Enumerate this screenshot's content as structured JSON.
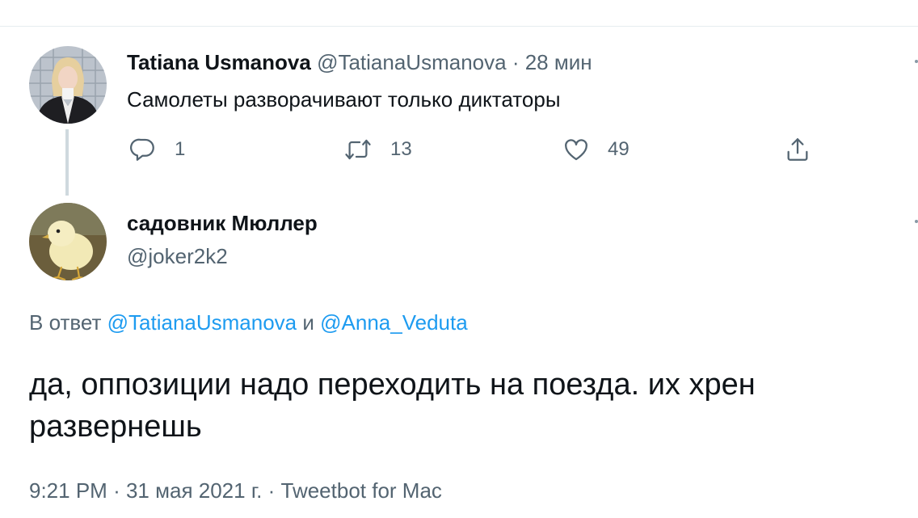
{
  "tweet1": {
    "name": "Tatiana Usmanova",
    "handle": "@TatianaUsmanova",
    "separator": "·",
    "time": "28 мин",
    "text": "Самолеты разворачивают только диктаторы",
    "actions": {
      "reply_count": "1",
      "retweet_count": "13",
      "like_count": "49"
    }
  },
  "tweet2": {
    "name": "садовник Мюллер",
    "handle": "@joker2k2",
    "reply_prefix": "В ответ",
    "reply_mention_1": "@TatianaUsmanova",
    "reply_and": "и",
    "reply_mention_2": "@Anna_Veduta",
    "text": "да, оппозиции надо переходить на поезда. их хрен развернешь",
    "timestamp": "9:21 PM",
    "separator": "·",
    "date": "31 мая 2021 г.",
    "client": "Tweetbot for Mac"
  },
  "icons": [
    "reply-icon",
    "retweet-icon",
    "like-icon",
    "share-icon"
  ],
  "colors": {
    "text": "#0f1419",
    "secondary": "#536471",
    "link": "#1d9bf0",
    "divider": "#e6ecf0"
  }
}
